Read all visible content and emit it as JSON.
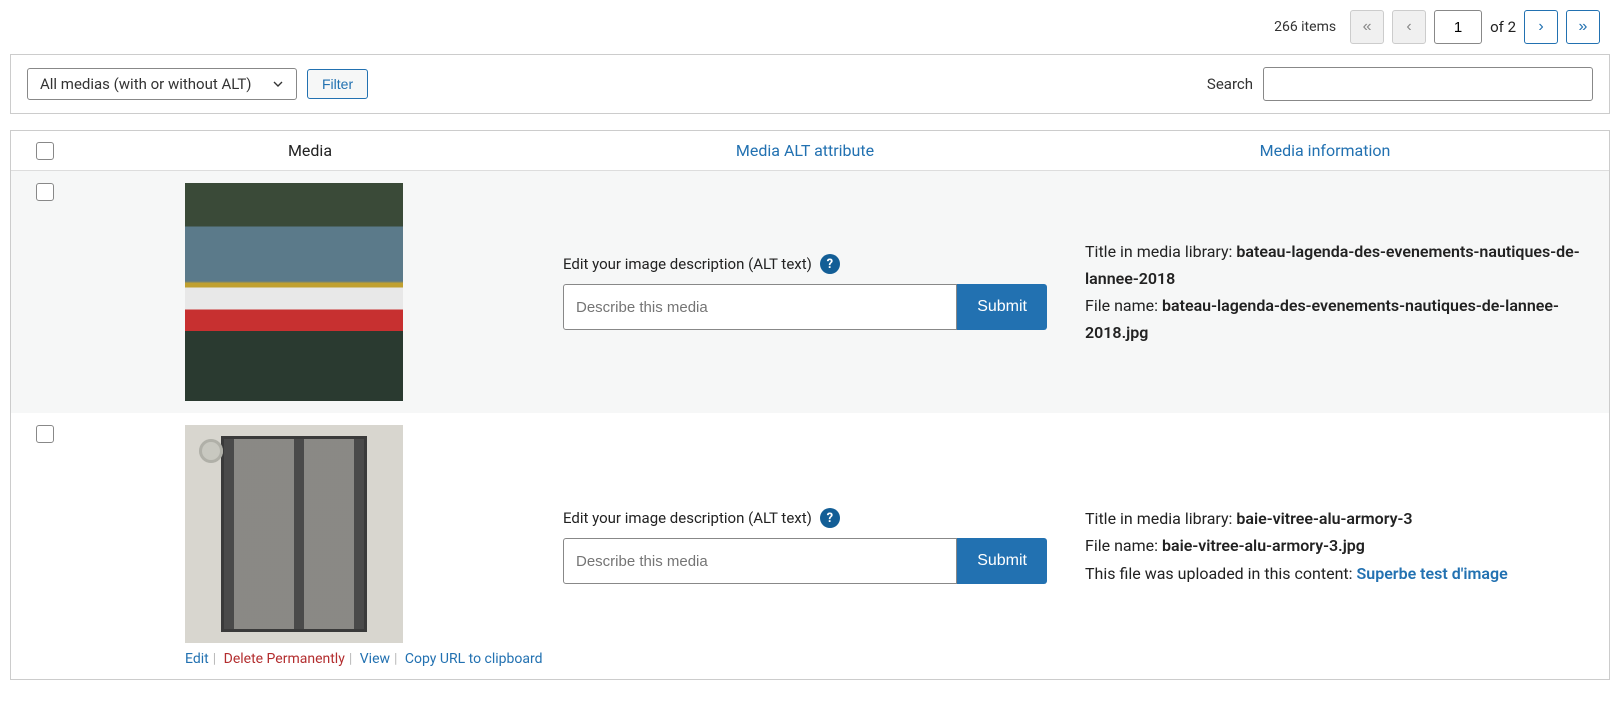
{
  "pagination": {
    "items_text": "266 items",
    "first": "«",
    "prev": "‹",
    "current": "1",
    "of_text": "of 2",
    "next": "›",
    "last": "»"
  },
  "filter": {
    "select_value": "All medias (with or without ALT)",
    "filter_btn": "Filter",
    "search_label": "Search"
  },
  "columns": {
    "media": "Media",
    "alt": "Media ALT attribute",
    "info": "Media information"
  },
  "alt_widget": {
    "label": "Edit your image description (ALT text)",
    "placeholder": "Describe this media",
    "submit": "Submit",
    "help": "?"
  },
  "info_labels": {
    "title": "Title in media library: ",
    "filename": "File name: ",
    "uploaded_in": "This file was uploaded in this content: "
  },
  "row_actions": {
    "edit": "Edit",
    "delete": "Delete Permanently",
    "view": "View",
    "copy": "Copy URL to clipboard"
  },
  "rows": [
    {
      "title_value": "bateau-lagenda-des-evenements-nautiques-de-lannee-2018",
      "filename_value": "bateau-lagenda-des-evenements-nautiques-de-lannee-2018.jpg",
      "content_link": null
    },
    {
      "title_value": "baie-vitree-alu-armory-3",
      "filename_value": "baie-vitree-alu-armory-3.jpg",
      "content_link": "Superbe test d'image"
    }
  ]
}
